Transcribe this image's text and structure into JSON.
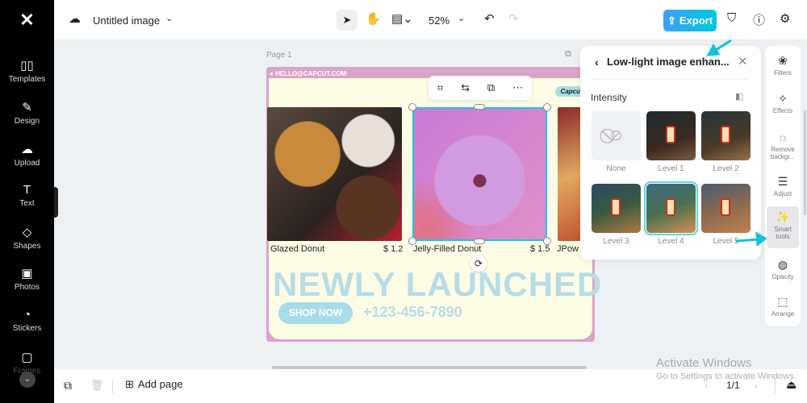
{
  "app": {
    "logo": "CapCut",
    "title": "Untitled image"
  },
  "sidebar": {
    "items": [
      {
        "label": "Templates",
        "icon": "▯▯"
      },
      {
        "label": "Design",
        "icon": "✎"
      },
      {
        "label": "Upload",
        "icon": "☁"
      },
      {
        "label": "Text",
        "icon": "T"
      },
      {
        "label": "Shapes",
        "icon": "◇"
      },
      {
        "label": "Photos",
        "icon": "▣"
      },
      {
        "label": "Stickers",
        "icon": "◔"
      },
      {
        "label": "Frames",
        "icon": "▢"
      }
    ]
  },
  "toolbar": {
    "zoom": "52%",
    "export_label": "Export"
  },
  "canvas": {
    "page_label": "Page 1",
    "email": "HELLO@CAPCUT.COM",
    "brand": "Capcut",
    "headline": "NEWLY LAUNCHED",
    "shop_button": "SHOP NOW",
    "phone": "+123-456-7890",
    "products": [
      {
        "name": "Glazed Donut",
        "price": "$ 1.2"
      },
      {
        "name": "Jelly-Filled Donut",
        "price": "$ 1.5"
      },
      {
        "name": "JPow",
        "price": ""
      }
    ]
  },
  "panel": {
    "title": "Low-light image enhan...",
    "section": "Intensity",
    "options": [
      {
        "label": "None"
      },
      {
        "label": "Level 1"
      },
      {
        "label": "Level 2"
      },
      {
        "label": "Level 3"
      },
      {
        "label": "Level 4"
      },
      {
        "label": "Level 5"
      }
    ],
    "selected": "Level 4"
  },
  "right_tools": [
    {
      "label": "Filters",
      "icon": "❀"
    },
    {
      "label": "Effects",
      "icon": "✧"
    },
    {
      "label": "Remove backgr...",
      "icon": "◌"
    },
    {
      "label": "Adjust",
      "icon": "☰"
    },
    {
      "label": "Smart tools",
      "icon": "✨"
    },
    {
      "label": "Opacity",
      "icon": "◍"
    },
    {
      "label": "Arrange",
      "icon": "⬚"
    }
  ],
  "bottom": {
    "add_page": "Add page",
    "page_count": "1/1"
  },
  "watermark": {
    "title": "Activate Windows",
    "subtitle": "Go to Settings to activate Windows."
  },
  "colors": {
    "accent": "#00c8e0",
    "sidebar": "#000000",
    "page_border": "#d9a4c9",
    "headline": "#b7dde6"
  }
}
